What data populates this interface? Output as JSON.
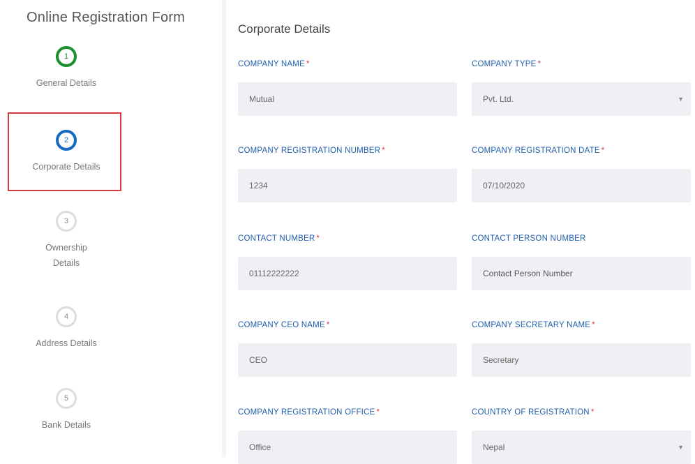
{
  "sidebar": {
    "title": "Online Registration Form",
    "steps": [
      {
        "number": "1",
        "label": "General Details",
        "state": "done"
      },
      {
        "number": "2",
        "label": "Corporate Details",
        "state": "active"
      },
      {
        "number": "3",
        "label": "Ownership Details",
        "state": "pending"
      },
      {
        "number": "4",
        "label": "Address Details",
        "state": "pending"
      },
      {
        "number": "5",
        "label": "Bank Details",
        "state": "pending"
      }
    ]
  },
  "main": {
    "section_title": "Corporate Details",
    "required_mark": "*",
    "fields": {
      "company_name": {
        "label": "COMPANY NAME",
        "value": "Mutual"
      },
      "company_type": {
        "label": "COMPANY TYPE",
        "value": "Pvt. Ltd.",
        "caret": "▼"
      },
      "reg_number": {
        "label": "COMPANY REGISTRATION NUMBER",
        "value": "1234"
      },
      "reg_date": {
        "label": "COMPANY REGISTRATION DATE",
        "value": "07/10/2020"
      },
      "contact_number": {
        "label": "CONTACT NUMBER",
        "value": "01112222222"
      },
      "contact_person_number": {
        "label": "CONTACT PERSON NUMBER",
        "placeholder": "Contact Person Number"
      },
      "ceo_name": {
        "label": "COMPANY CEO NAME",
        "value": "CEO"
      },
      "secretary_name": {
        "label": "COMPANY SECRETARY NAME",
        "value": "Secretary"
      },
      "reg_office": {
        "label": "COMPANY REGISTRATION OFFICE",
        "value": "Office"
      },
      "country": {
        "label": "COUNTRY OF REGISTRATION",
        "value": "Nepal",
        "caret": "▼"
      }
    }
  },
  "colors": {
    "done": "#1a8f2e",
    "active": "#1769c4",
    "label_blue": "#1f5fae",
    "required_red": "#d83a3a",
    "highlight_red": "#d63a3a"
  }
}
